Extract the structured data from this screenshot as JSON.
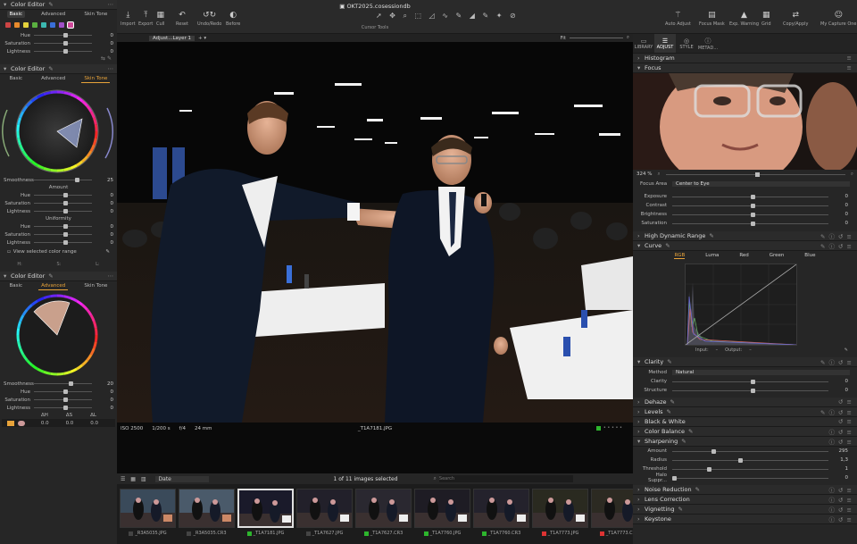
{
  "left": {
    "editor1": {
      "title": "Color Editor",
      "tabs": [
        "Basic",
        "Advanced",
        "Skin Tone"
      ],
      "active_tab": "Basic",
      "swatches": [
        "#c44",
        "#e88a2c",
        "#e3d23c",
        "#5ab040",
        "#3cb8b0",
        "#3a6fd8",
        "#a050c8",
        "#d04a9a"
      ],
      "sliders": [
        {
          "label": "Hue",
          "value": "0",
          "pos": 0.5
        },
        {
          "label": "Saturation",
          "value": "0",
          "pos": 0.5
        },
        {
          "label": "Lightness",
          "value": "0",
          "pos": 0.5
        }
      ]
    },
    "editor2": {
      "title": "Color Editor",
      "tabs": [
        "Basic",
        "Advanced",
        "Skin Tone"
      ],
      "active_tab": "Skin Tone",
      "smoothness": {
        "label": "Smoothness",
        "value": "25",
        "pos": 0.7
      },
      "amount_label": "Amount",
      "amount": [
        {
          "label": "Hue",
          "value": "0",
          "pos": 0.5
        },
        {
          "label": "Saturation",
          "value": "0",
          "pos": 0.5
        },
        {
          "label": "Lightness",
          "value": "0",
          "pos": 0.5
        }
      ],
      "uniformity_label": "Uniformity",
      "uniformity": [
        {
          "label": "Hue",
          "value": "0",
          "pos": 0.5
        },
        {
          "label": "Saturation",
          "value": "0",
          "pos": 0.5
        },
        {
          "label": "Lightness",
          "value": "0",
          "pos": 0.5
        }
      ],
      "view_range": "View selected color range",
      "coords": [
        "H:",
        "S:",
        "L:"
      ]
    },
    "editor3": {
      "title": "Color Editor",
      "tabs": [
        "Basic",
        "Advanced",
        "Skin Tone"
      ],
      "active_tab": "Advanced",
      "sliders": [
        {
          "label": "Smoothness",
          "value": "20",
          "pos": 0.6
        },
        {
          "label": "Hue",
          "value": "0",
          "pos": 0.5
        },
        {
          "label": "Saturation",
          "value": "0",
          "pos": 0.5
        },
        {
          "label": "Lightness",
          "value": "0",
          "pos": 0.5
        }
      ],
      "table_headers": [
        "ΔH",
        "ΔS",
        "ΔL"
      ],
      "table_row": [
        "0.0",
        "0.0",
        "0.0"
      ]
    }
  },
  "toolbar": {
    "title": "OKT2025.cosessiondb",
    "left_buttons": [
      "Import",
      "Export",
      "Cull",
      "Reset",
      "Undo/Redo",
      "Before"
    ],
    "cursor_tools": "Cursor Tools"
  },
  "viewer": {
    "layer": "Adjust...Layer 1",
    "fit": "Fit",
    "iso": "ISO 2500",
    "shutter": "1/200 s",
    "aperture": "f/4",
    "focal": "24 mm",
    "filename": "_T1A7181.JPG"
  },
  "filmstrip": {
    "sort": "Date",
    "count": "1 of 11 images selected",
    "search_placeholder": "Search",
    "thumbs": [
      {
        "name": "_R3A5035.JPG",
        "tag": "#444"
      },
      {
        "name": "_R3A5035.CR3",
        "tag": "#444"
      },
      {
        "name": "_T1A7181.JPG",
        "tag": "#2db52d"
      },
      {
        "name": "_T1A7627.JPG",
        "tag": "#444"
      },
      {
        "name": "_T1A7627.CR3",
        "tag": "#2db52d"
      },
      {
        "name": "_T1A7760.JPG",
        "tag": "#2db52d"
      },
      {
        "name": "_T1A7760.CR3",
        "tag": "#2db52d"
      },
      {
        "name": "_T1A7773.JPG",
        "tag": "#d33"
      },
      {
        "name": "_T1A7773.CR3",
        "tag": "#d33"
      }
    ]
  },
  "right": {
    "buttons": [
      "Auto Adjust",
      "Focus Mask",
      "Exp. Warning",
      "Grid",
      "Copy/Apply",
      "My Capture One"
    ],
    "tabs": [
      "LIBRARY",
      "ADJUST",
      "STYLE",
      "METAD..."
    ],
    "active_tab": "ADJUST",
    "histogram": "Histogram",
    "focus": "Focus",
    "zoom": "324 %",
    "focus_area_label": "Focus Area",
    "focus_area_value": "Center to Eye",
    "exposure": [
      {
        "label": "Exposure",
        "value": "0",
        "pos": 0.5
      },
      {
        "label": "Contrast",
        "value": "0",
        "pos": 0.5
      },
      {
        "label": "Brightness",
        "value": "0",
        "pos": 0.5
      },
      {
        "label": "Saturation",
        "value": "0",
        "pos": 0.5
      }
    ],
    "hdr": "High Dynamic Range",
    "curve": "Curve",
    "curve_tabs": [
      "RGB",
      "Luma",
      "Red",
      "Green",
      "Blue"
    ],
    "curve_input": "Input:",
    "curve_output": "Output:",
    "clarity": "Clarity",
    "clarity_method_label": "Method",
    "clarity_method": "Natural",
    "clarity_sliders": [
      {
        "label": "Clarity",
        "value": "0",
        "pos": 0.5
      },
      {
        "label": "Structure",
        "value": "0",
        "pos": 0.5
      }
    ],
    "dehaze": "Dehaze",
    "levels": "Levels",
    "bw": "Black & White",
    "color_balance": "Color Balance",
    "sharpening": "Sharpening",
    "sharp_sliders": [
      {
        "label": "Amount",
        "value": "295",
        "pos": 0.25
      },
      {
        "label": "Radius",
        "value": "1,3",
        "pos": 0.42
      },
      {
        "label": "Threshold",
        "value": "1",
        "pos": 0.22
      },
      {
        "label": "Halo Suppr...",
        "value": "0",
        "pos": 0.0
      }
    ],
    "noise": "Noise Reduction",
    "lens": "Lens Correction",
    "vignetting": "Vignetting",
    "keystone": "Keystone"
  }
}
